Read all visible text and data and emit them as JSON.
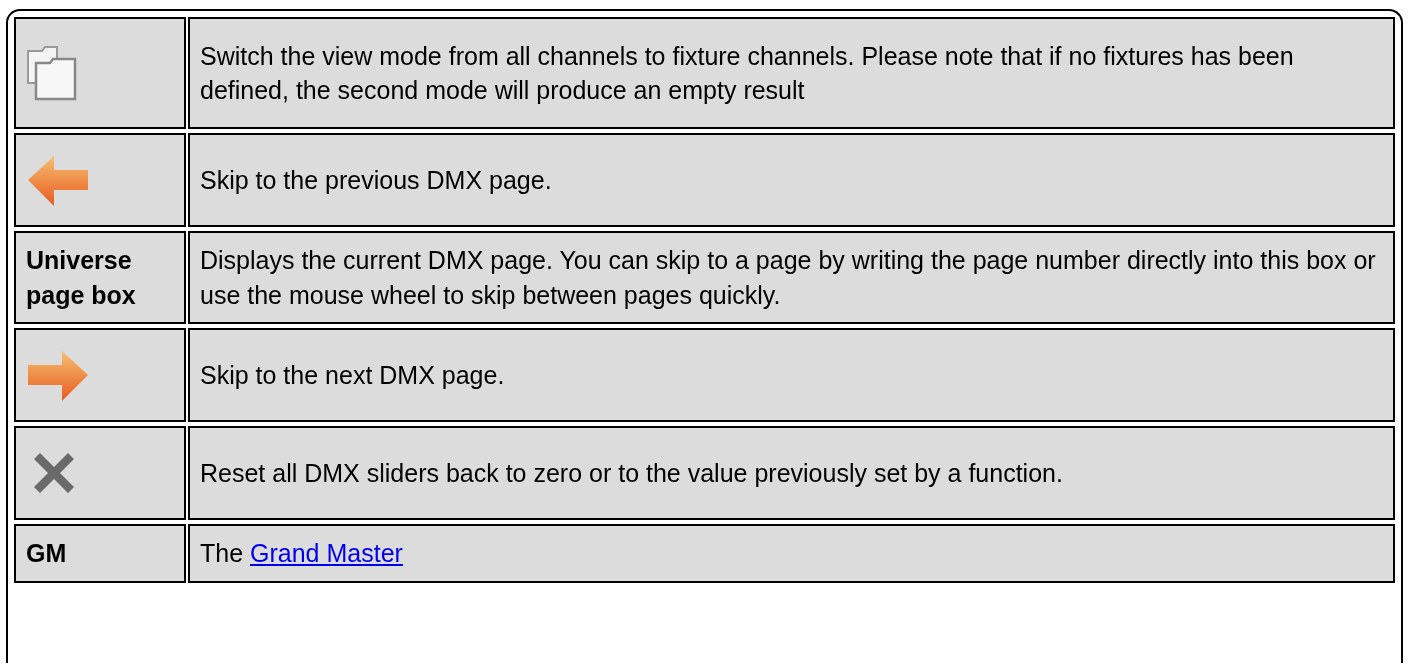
{
  "rows": [
    {
      "kind": "folders",
      "description": "Switch the view mode from all channels to fixture channels. Please note that if no fixtures has been defined, the second mode will produce an empty result"
    },
    {
      "kind": "back",
      "description": "Skip to the previous DMX page."
    },
    {
      "kind": "label",
      "label": "Universe page box",
      "description": "Displays the current DMX page. You can skip to a page by writing the page number directly into this box or use the mouse wheel to skip between pages quickly."
    },
    {
      "kind": "forward",
      "description": "Skip to the next DMX page."
    },
    {
      "kind": "reset",
      "description": "Reset all DMX sliders back to zero or to the value previously set by a function."
    },
    {
      "kind": "label",
      "label": "GM",
      "description": "The ",
      "link": "Grand Master"
    }
  ]
}
